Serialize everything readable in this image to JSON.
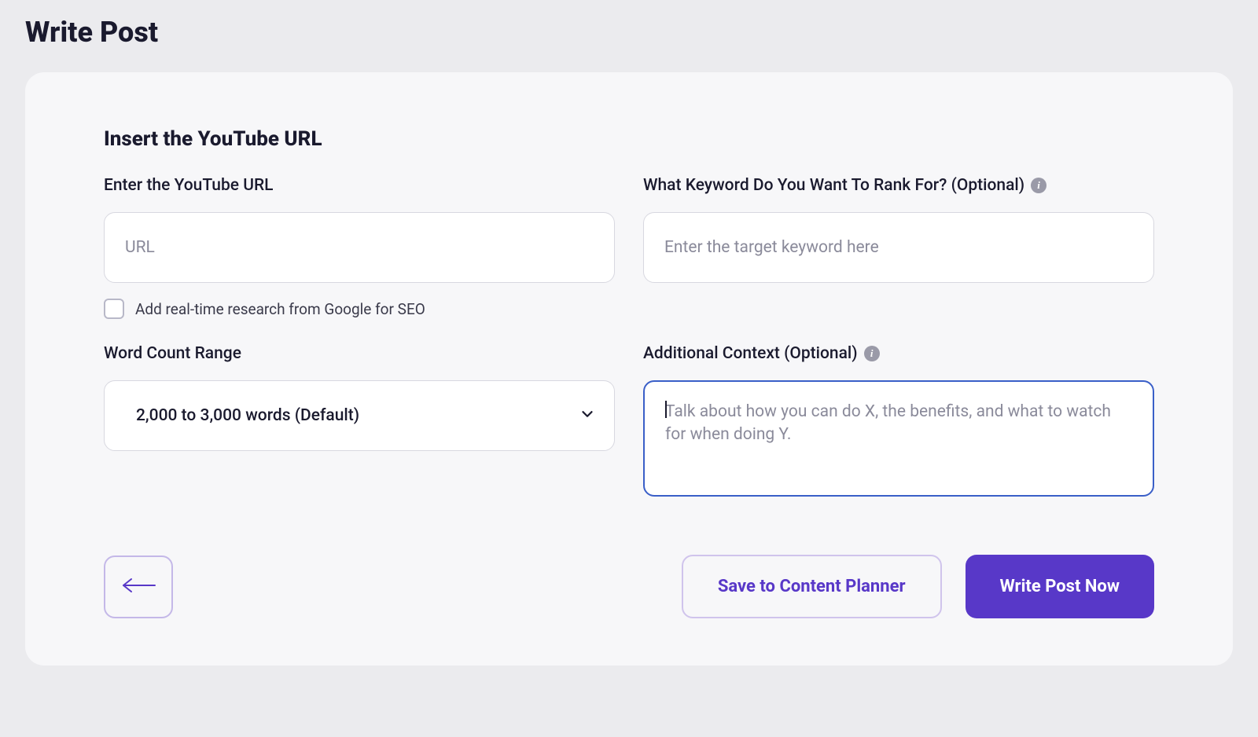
{
  "page": {
    "title": "Write Post"
  },
  "section": {
    "title": "Insert the YouTube URL"
  },
  "fields": {
    "url": {
      "label": "Enter the YouTube URL",
      "placeholder": "URL",
      "value": ""
    },
    "keyword": {
      "label": "What Keyword Do You Want To Rank For? (Optional)",
      "placeholder": "Enter the target keyword here",
      "value": ""
    },
    "research_checkbox": {
      "label": "Add real-time research from Google for SEO",
      "checked": false
    },
    "word_count": {
      "label": "Word Count Range",
      "selected": "2,000 to 3,000 words (Default)"
    },
    "context": {
      "label": "Additional Context (Optional)",
      "placeholder": "Talk about how you can do X, the benefits, and what to watch for when doing Y.",
      "value": ""
    }
  },
  "buttons": {
    "save": "Save to Content Planner",
    "write": "Write Post Now"
  },
  "icons": {
    "info": "i"
  }
}
